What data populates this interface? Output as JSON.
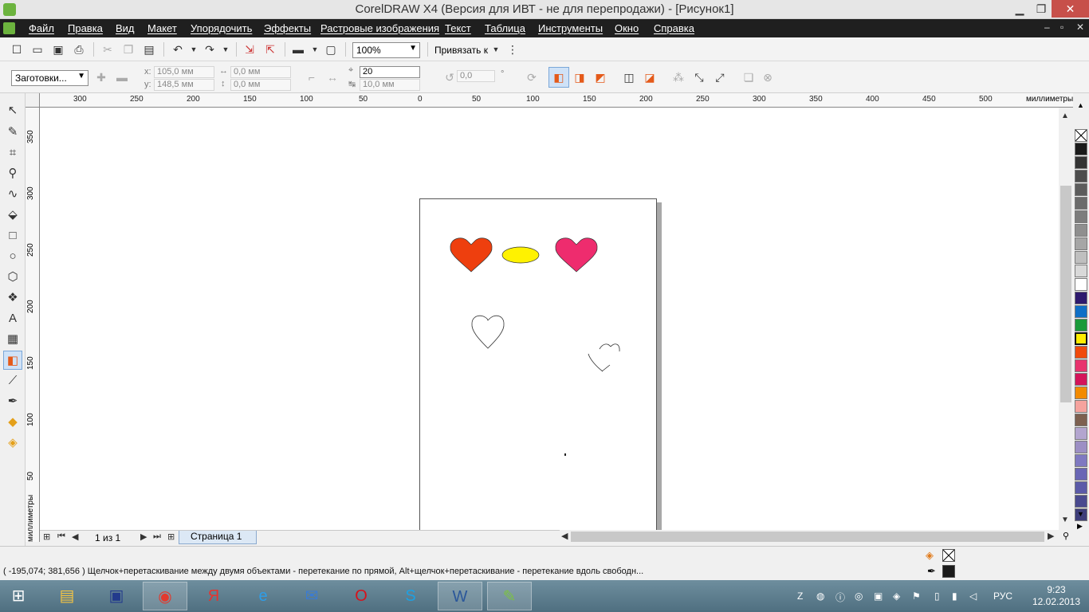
{
  "window": {
    "title": "CorelDRAW X4 (Версия для ИВТ - не для перепродажи) - [Рисунок1]",
    "min_glyph": "▁",
    "max_glyph": "❐",
    "close_glyph": "✕"
  },
  "menu": {
    "items": [
      "Файл",
      "Правка",
      "Вид",
      "Макет",
      "Упорядочить",
      "Эффекты",
      "Растровые изображения",
      "Текст",
      "Таблица",
      "Инструменты",
      "Окно",
      "Справка"
    ],
    "doc_min": "–",
    "doc_max": "▫",
    "doc_close": "✕"
  },
  "toolbar": {
    "zoom_value": "100%",
    "snap_label": "Привязать к"
  },
  "property_bar": {
    "preset": "Заготовки...",
    "x_label": "x:",
    "x_value": "105,0 мм",
    "y_label": "y:",
    "y_value": "148,5 мм",
    "w_value": "0,0 мм",
    "h_value": "0,0 мм",
    "steps_value": "20",
    "spacing_value": "10,0 мм",
    "angle_value": "0,0",
    "degree": "°"
  },
  "ruler": {
    "h_ticks": [
      "300",
      "250",
      "200",
      "150",
      "100",
      "50",
      "0",
      "50",
      "100",
      "150",
      "200",
      "250",
      "300",
      "350",
      "400",
      "450",
      "500"
    ],
    "v_ticks": [
      "350",
      "300",
      "250",
      "200",
      "150",
      "100",
      "50"
    ],
    "unit": "миллиметры"
  },
  "page_nav": {
    "count": "1 из 1",
    "tab": "Страница 1"
  },
  "palette": {
    "colors": [
      "#1a1a1a",
      "#333333",
      "#4d4d4d",
      "#5c5c5c",
      "#6b6b6b",
      "#7d7d7d",
      "#8f8f8f",
      "#a6a6a6",
      "#bfbfbf",
      "#d9d9d9",
      "#ffffff",
      "#2e1a6e",
      "#0f6fc6",
      "#1a9a3a",
      "#ffec00",
      "#f04a0c",
      "#e8336e",
      "#d4145a",
      "#f28a00",
      "#f5a39e",
      "#7d6050",
      "#b3a5cf",
      "#9c8fc4",
      "#7f79c1",
      "#6966b5",
      "#5b5aa8",
      "#4a4a8f",
      "#3d3d7a"
    ]
  },
  "statusbar": {
    "message": "( -195,074; 381,656 )   Щелчок+перетаскивание между двумя объектами - перетекание по прямой, Alt+щелчок+перетаскивание - перетекание вдоль свободн..."
  },
  "taskbar": {
    "lang": "РУС",
    "time": "9:23",
    "date": "12.02.2013"
  },
  "colors": {
    "heart_left": "#ee3f0e",
    "ellipse": "#fff200",
    "heart_right": "#ee2c6e"
  }
}
